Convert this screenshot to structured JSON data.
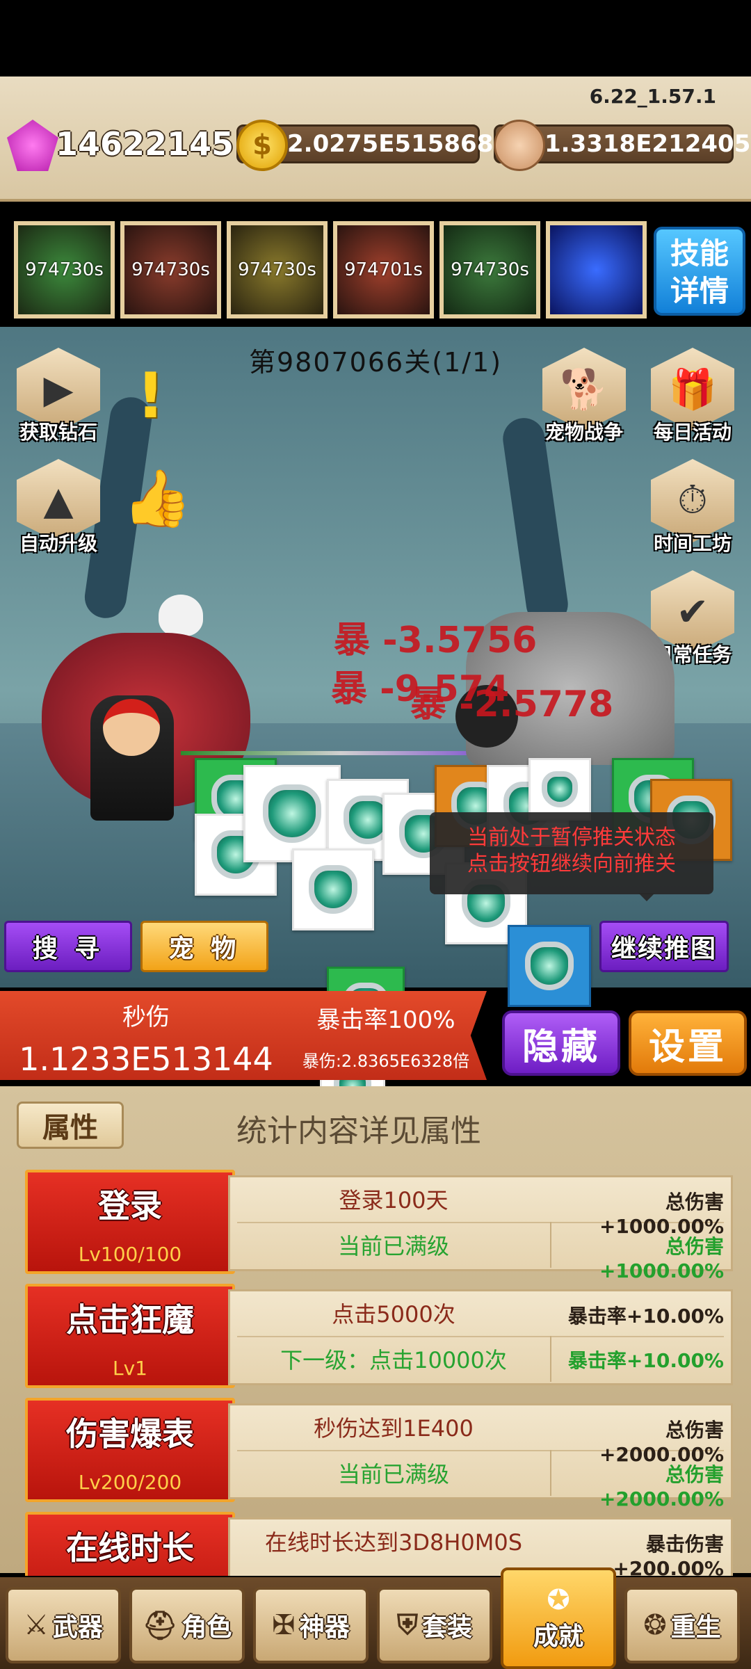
{
  "version": "6.22_1.57.1",
  "currencies": {
    "gems": "14622145",
    "gold": "2.0275E515868",
    "skulls": "1.3318E212405"
  },
  "skills": [
    "974730s",
    "974730s",
    "974730s",
    "974701s",
    "974730s"
  ],
  "skill_detail_label": "技能详情",
  "stage_title": "第9807066关(1/1)",
  "left_buttons": {
    "get_diamond": "获取钻石",
    "auto_upgrade": "自动升级"
  },
  "right_buttons": {
    "pet_war": "宠物战争",
    "daily_activity": "每日活动",
    "time_workshop": "时间工坊",
    "daily_task": "日常任务"
  },
  "damage_numbers": [
    "暴 -3.5756",
    "暴 -9.574",
    "暴 -2.5778"
  ],
  "tooltip": {
    "line1": "当前处于暂停推关状态",
    "line2": "点击按钮继续向前推关"
  },
  "buttons": {
    "search": "搜 寻",
    "pet": "宠 物",
    "continue": "继续推图",
    "hide": "隐藏",
    "settings": "设置"
  },
  "stats": {
    "dps_label": "秒伤",
    "dps_value": "1.1233E513144",
    "crit_rate": "暴击率100%",
    "crit_mult": "暴伤:2.8365E6328倍"
  },
  "attr_tab": "属性",
  "attr_note": "统计内容详见属性",
  "achievements": [
    {
      "name": "登录",
      "level": "Lv100/100",
      "desc": "登录100天",
      "next": "当前已满级",
      "bonus": "总伤害+1000.00%",
      "bonus_next": "总伤害+1000.00%"
    },
    {
      "name": "点击狂魔",
      "level": "Lv1",
      "desc": "点击5000次",
      "next": "下一级：点击10000次",
      "bonus": "暴击率+10.00%",
      "bonus_next": "暴击率+10.00%"
    },
    {
      "name": "伤害爆表",
      "level": "Lv200/200",
      "desc": "秒伤达到1E400",
      "next": "当前已满级",
      "bonus": "总伤害+2000.00%",
      "bonus_next": "总伤害+2000.00%"
    },
    {
      "name": "在线时长",
      "level": "",
      "desc": "在线时长达到3D8H0M0S",
      "next": "",
      "bonus": "暴击伤害+200.00%",
      "bonus_next": ""
    }
  ],
  "nav": {
    "weapon": "武器",
    "role": "角色",
    "artifact": "神器",
    "set": "套装",
    "achievement": "成就",
    "rebirth": "重生"
  }
}
